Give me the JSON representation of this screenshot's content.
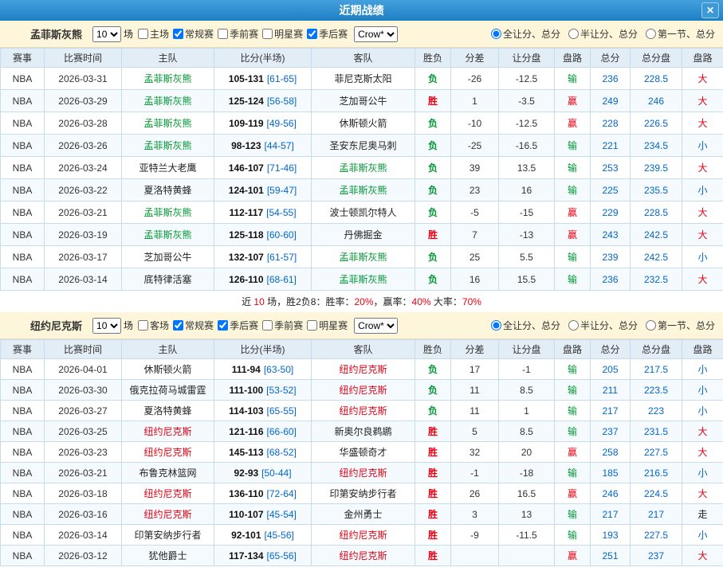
{
  "titlebar": {
    "title": "近期战绩",
    "close_glyph": "✕"
  },
  "sections": [
    {
      "team": "孟菲斯灰熊",
      "games_count": "10",
      "games_unit": "场",
      "bookmaker": "Crow*",
      "checkboxes": [
        {
          "label": "主场",
          "checked": false
        },
        {
          "label": "常规赛",
          "checked": true
        },
        {
          "label": "季前赛",
          "checked": false
        },
        {
          "label": "明星赛",
          "checked": false
        },
        {
          "label": "季后赛",
          "checked": true
        }
      ],
      "radios": [
        {
          "label": "全让分、总分",
          "selected": true
        },
        {
          "label": "半让分、总分",
          "selected": false
        },
        {
          "label": "第一节、总分",
          "selected": false
        }
      ],
      "columns": [
        "赛事",
        "比赛时间",
        "主队",
        "比分(半场)",
        "客队",
        "胜负",
        "分差",
        "让分盘",
        "盘路",
        "总分",
        "总分盘",
        "盘路"
      ],
      "rows": [
        {
          "league": "NBA",
          "date": "2026-03-31",
          "home": "孟菲斯灰熊",
          "home_c": "green",
          "score": "105-131",
          "half": "[61-65]",
          "away": "菲尼克斯太阳",
          "away_c": "black",
          "wl": "负",
          "wl_c": "green",
          "diff": "-26",
          "line": "-12.5",
          "cover": "输",
          "cover_c": "green",
          "total": "236",
          "total_line": "228.5",
          "ou": "大",
          "ou_c": "red"
        },
        {
          "league": "NBA",
          "date": "2026-03-29",
          "home": "孟菲斯灰熊",
          "home_c": "green",
          "score": "125-124",
          "half": "[56-58]",
          "away": "芝加哥公牛",
          "away_c": "black",
          "wl": "胜",
          "wl_c": "red",
          "diff": "1",
          "line": "-3.5",
          "cover": "赢",
          "cover_c": "red",
          "total": "249",
          "total_line": "246",
          "ou": "大",
          "ou_c": "red"
        },
        {
          "league": "NBA",
          "date": "2026-03-28",
          "home": "孟菲斯灰熊",
          "home_c": "green",
          "score": "109-119",
          "half": "[49-56]",
          "away": "休斯顿火箭",
          "away_c": "black",
          "wl": "负",
          "wl_c": "green",
          "diff": "-10",
          "line": "-12.5",
          "cover": "赢",
          "cover_c": "red",
          "total": "228",
          "total_line": "226.5",
          "ou": "大",
          "ou_c": "red"
        },
        {
          "league": "NBA",
          "date": "2026-03-26",
          "home": "孟菲斯灰熊",
          "home_c": "green",
          "score": "98-123",
          "half": "[44-57]",
          "away": "圣安东尼奥马刺",
          "away_c": "black",
          "wl": "负",
          "wl_c": "green",
          "diff": "-25",
          "line": "-16.5",
          "cover": "输",
          "cover_c": "green",
          "total": "221",
          "total_line": "234.5",
          "ou": "小",
          "ou_c": "blue"
        },
        {
          "league": "NBA",
          "date": "2026-03-24",
          "home": "亚特兰大老鹰",
          "home_c": "black",
          "score": "146-107",
          "half": "[71-46]",
          "away": "孟菲斯灰熊",
          "away_c": "green",
          "wl": "负",
          "wl_c": "green",
          "diff": "39",
          "line": "13.5",
          "cover": "输",
          "cover_c": "green",
          "total": "253",
          "total_line": "239.5",
          "ou": "大",
          "ou_c": "red"
        },
        {
          "league": "NBA",
          "date": "2026-03-22",
          "home": "夏洛特黄蜂",
          "home_c": "black",
          "score": "124-101",
          "half": "[59-47]",
          "away": "孟菲斯灰熊",
          "away_c": "green",
          "wl": "负",
          "wl_c": "green",
          "diff": "23",
          "line": "16",
          "cover": "输",
          "cover_c": "green",
          "total": "225",
          "total_line": "235.5",
          "ou": "小",
          "ou_c": "blue"
        },
        {
          "league": "NBA",
          "date": "2026-03-21",
          "home": "孟菲斯灰熊",
          "home_c": "green",
          "score": "112-117",
          "half": "[54-55]",
          "away": "波士顿凯尔特人",
          "away_c": "black",
          "wl": "负",
          "wl_c": "green",
          "diff": "-5",
          "line": "-15",
          "cover": "赢",
          "cover_c": "red",
          "total": "229",
          "total_line": "228.5",
          "ou": "大",
          "ou_c": "red"
        },
        {
          "league": "NBA",
          "date": "2026-03-19",
          "home": "孟菲斯灰熊",
          "home_c": "green",
          "score": "125-118",
          "half": "[60-60]",
          "away": "丹佛掘金",
          "away_c": "black",
          "wl": "胜",
          "wl_c": "red",
          "diff": "7",
          "line": "-13",
          "cover": "赢",
          "cover_c": "red",
          "total": "243",
          "total_line": "242.5",
          "ou": "大",
          "ou_c": "red"
        },
        {
          "league": "NBA",
          "date": "2026-03-17",
          "home": "芝加哥公牛",
          "home_c": "black",
          "score": "132-107",
          "half": "[61-57]",
          "away": "孟菲斯灰熊",
          "away_c": "green",
          "wl": "负",
          "wl_c": "green",
          "diff": "25",
          "line": "5.5",
          "cover": "输",
          "cover_c": "green",
          "total": "239",
          "total_line": "242.5",
          "ou": "小",
          "ou_c": "blue"
        },
        {
          "league": "NBA",
          "date": "2026-03-14",
          "home": "底特律活塞",
          "home_c": "black",
          "score": "126-110",
          "half": "[68-61]",
          "away": "孟菲斯灰熊",
          "away_c": "green",
          "wl": "负",
          "wl_c": "green",
          "diff": "16",
          "line": "15.5",
          "cover": "输",
          "cover_c": "green",
          "total": "236",
          "total_line": "232.5",
          "ou": "大",
          "ou_c": "red"
        }
      ],
      "summary": [
        {
          "t": "近 ",
          "c": "black"
        },
        {
          "t": "10",
          "c": "red"
        },
        {
          "t": " 场，胜2负8：胜率：",
          "c": "black"
        },
        {
          "t": "20%",
          "c": "red"
        },
        {
          "t": "，赢率：",
          "c": "black"
        },
        {
          "t": "40%",
          "c": "red"
        },
        {
          "t": " 大率：",
          "c": "black"
        },
        {
          "t": "70%",
          "c": "red"
        }
      ]
    },
    {
      "team": "纽约尼克斯",
      "games_count": "10",
      "games_unit": "场",
      "bookmaker": "Crow*",
      "checkboxes": [
        {
          "label": "客场",
          "checked": false
        },
        {
          "label": "常规赛",
          "checked": true
        },
        {
          "label": "季后赛",
          "checked": true
        },
        {
          "label": "季前赛",
          "checked": false
        },
        {
          "label": "明星赛",
          "checked": false
        }
      ],
      "radios": [
        {
          "label": "全让分、总分",
          "selected": true
        },
        {
          "label": "半让分、总分",
          "selected": false
        },
        {
          "label": "第一节、总分",
          "selected": false
        }
      ],
      "columns": [
        "赛事",
        "比赛时间",
        "主队",
        "比分(半场)",
        "客队",
        "胜负",
        "分差",
        "让分盘",
        "盘路",
        "总分",
        "总分盘",
        "盘路"
      ],
      "rows": [
        {
          "league": "NBA",
          "date": "2026-04-01",
          "home": "休斯顿火箭",
          "home_c": "black",
          "score": "111-94",
          "half": "[63-50]",
          "away": "纽约尼克斯",
          "away_c": "red",
          "wl": "负",
          "wl_c": "green",
          "diff": "17",
          "line": "-1",
          "cover": "输",
          "cover_c": "green",
          "total": "205",
          "total_line": "217.5",
          "ou": "小",
          "ou_c": "blue"
        },
        {
          "league": "NBA",
          "date": "2026-03-30",
          "home": "俄克拉荷马城雷霆",
          "home_c": "black",
          "score": "111-100",
          "half": "[53-52]",
          "away": "纽约尼克斯",
          "away_c": "red",
          "wl": "负",
          "wl_c": "green",
          "diff": "11",
          "line": "8.5",
          "cover": "输",
          "cover_c": "green",
          "total": "211",
          "total_line": "223.5",
          "ou": "小",
          "ou_c": "blue"
        },
        {
          "league": "NBA",
          "date": "2026-03-27",
          "home": "夏洛特黄蜂",
          "home_c": "black",
          "score": "114-103",
          "half": "[65-55]",
          "away": "纽约尼克斯",
          "away_c": "red",
          "wl": "负",
          "wl_c": "green",
          "diff": "11",
          "line": "1",
          "cover": "输",
          "cover_c": "green",
          "total": "217",
          "total_line": "223",
          "ou": "小",
          "ou_c": "blue"
        },
        {
          "league": "NBA",
          "date": "2026-03-25",
          "home": "纽约尼克斯",
          "home_c": "red",
          "score": "121-116",
          "half": "[66-60]",
          "away": "新奥尔良鹈鹕",
          "away_c": "black",
          "wl": "胜",
          "wl_c": "red",
          "diff": "5",
          "line": "8.5",
          "cover": "输",
          "cover_c": "green",
          "total": "237",
          "total_line": "231.5",
          "ou": "大",
          "ou_c": "red"
        },
        {
          "league": "NBA",
          "date": "2026-03-23",
          "home": "纽约尼克斯",
          "home_c": "red",
          "score": "145-113",
          "half": "[68-52]",
          "away": "华盛顿奇才",
          "away_c": "black",
          "wl": "胜",
          "wl_c": "red",
          "diff": "32",
          "line": "20",
          "cover": "赢",
          "cover_c": "red",
          "total": "258",
          "total_line": "227.5",
          "ou": "大",
          "ou_c": "red"
        },
        {
          "league": "NBA",
          "date": "2026-03-21",
          "home": "布鲁克林篮网",
          "home_c": "black",
          "score": "92-93",
          "half": "[50-44]",
          "away": "纽约尼克斯",
          "away_c": "red",
          "wl": "胜",
          "wl_c": "red",
          "diff": "-1",
          "line": "-18",
          "cover": "输",
          "cover_c": "green",
          "total": "185",
          "total_line": "216.5",
          "ou": "小",
          "ou_c": "blue"
        },
        {
          "league": "NBA",
          "date": "2026-03-18",
          "home": "纽约尼克斯",
          "home_c": "red",
          "score": "136-110",
          "half": "[72-64]",
          "away": "印第安纳步行者",
          "away_c": "black",
          "wl": "胜",
          "wl_c": "red",
          "diff": "26",
          "line": "16.5",
          "cover": "赢",
          "cover_c": "red",
          "total": "246",
          "total_line": "224.5",
          "ou": "大",
          "ou_c": "red"
        },
        {
          "league": "NBA",
          "date": "2026-03-16",
          "home": "纽约尼克斯",
          "home_c": "red",
          "score": "110-107",
          "half": "[45-54]",
          "away": "金州勇士",
          "away_c": "black",
          "wl": "胜",
          "wl_c": "red",
          "diff": "3",
          "line": "13",
          "cover": "输",
          "cover_c": "green",
          "total": "217",
          "total_line": "217",
          "ou": "走",
          "ou_c": "black"
        },
        {
          "league": "NBA",
          "date": "2026-03-14",
          "home": "印第安纳步行者",
          "home_c": "black",
          "score": "92-101",
          "half": "[45-56]",
          "away": "纽约尼克斯",
          "away_c": "red",
          "wl": "胜",
          "wl_c": "red",
          "diff": "-9",
          "line": "-11.5",
          "cover": "输",
          "cover_c": "green",
          "total": "193",
          "total_line": "227.5",
          "ou": "小",
          "ou_c": "blue"
        },
        {
          "league": "NBA",
          "date": "2026-03-12",
          "home": "犹他爵士",
          "home_c": "black",
          "score": "117-134",
          "half": "[65-56]",
          "away": "纽约尼克斯",
          "away_c": "red",
          "wl": "胜",
          "wl_c": "red",
          "diff": "",
          "line": "",
          "cover": "赢",
          "cover_c": "red",
          "total": "251",
          "total_line": "237",
          "ou": "大",
          "ou_c": "red"
        }
      ],
      "summary": []
    }
  ]
}
